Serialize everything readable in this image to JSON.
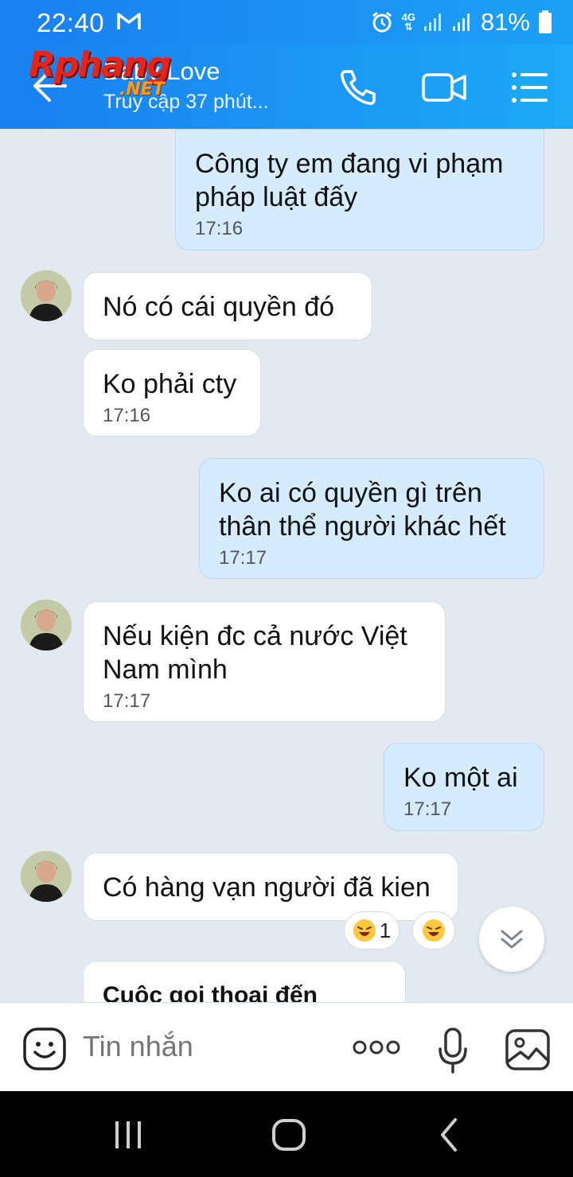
{
  "status_bar": {
    "time": "22:40",
    "network": "4G",
    "battery": "81%",
    "icons": [
      "gmail-icon",
      "alarm-icon",
      "signal-icon",
      "signal-icon",
      "battery-icon"
    ]
  },
  "header": {
    "contact_name": "Baby Love",
    "contact_status": "Truy cập 37 phút...",
    "watermark_main": "Rphang",
    "watermark_sub": ".NET",
    "icons": [
      "back-arrow-icon",
      "phone-icon",
      "video-camera-icon",
      "menu-list-icon"
    ]
  },
  "messages": [
    {
      "direction": "out",
      "lines": [
        "Công ty em đang vi phạm",
        "pháp luật đấy"
      ],
      "time": "17:16"
    },
    {
      "direction": "in",
      "lines": [
        "Nó có cái quyền đó"
      ],
      "time": ""
    },
    {
      "direction": "in",
      "lines": [
        "Ko phải cty"
      ],
      "time": "17:16"
    },
    {
      "direction": "out",
      "lines": [
        "Ko ai có quyền gì trên",
        "thân thể người khác hết"
      ],
      "time": "17:17"
    },
    {
      "direction": "in",
      "lines": [
        "Nếu kiện đc cả nước Việt",
        "Nam mình"
      ],
      "time": "17:17"
    },
    {
      "direction": "out",
      "lines": [
        "Ko một ai"
      ],
      "time": "17:17"
    },
    {
      "direction": "in",
      "lines": [
        "Có hàng vạn người đã kien"
      ],
      "time": ""
    },
    {
      "direction": "in",
      "lines": [
        "Cuộc gọi thoại đến"
      ],
      "time": ""
    }
  ],
  "reactions": {
    "count": "1",
    "icons": [
      "laughing-emoji-icon",
      "laughing-emoji-icon"
    ]
  },
  "composer": {
    "placeholder": "Tin nhắn",
    "icons": [
      "sticker-icon",
      "more-dots-icon",
      "microphone-icon",
      "image-icon"
    ]
  },
  "navbar": {
    "icons": [
      "recent-apps-icon",
      "home-icon",
      "back-icon"
    ]
  },
  "colors": {
    "header": "#1a8ff2",
    "outgoing_bubble": "#d4ecfd",
    "incoming_bubble": "#ffffff",
    "chat_bg": "#e2e9f1"
  }
}
